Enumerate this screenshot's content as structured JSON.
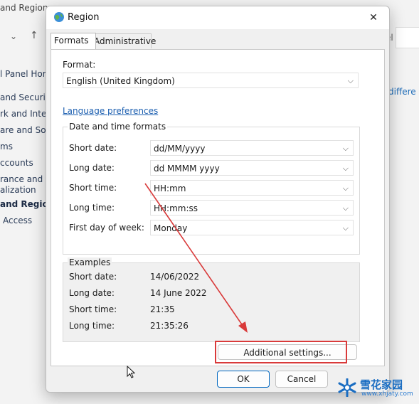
{
  "background": {
    "title": "and Region",
    "nav_chevron": "⌄",
    "nav_up": "↑",
    "right_top": "el",
    "right_link": "differe",
    "sidebar_items": [
      {
        "label": "l Panel Hom",
        "bold": false
      },
      {
        "label": "and Security",
        "bold": false
      },
      {
        "label": "rk and Intern",
        "bold": false
      },
      {
        "label": "are and Soun",
        "bold": false
      },
      {
        "label": "ms",
        "bold": false
      },
      {
        "label": "ccounts",
        "bold": false
      },
      {
        "label": "rance and",
        "bold": false
      },
      {
        "label": "alization",
        "bold": false
      },
      {
        "label": "and Region",
        "bold": true
      },
      {
        "label": "Access",
        "bold": false
      }
    ]
  },
  "dialog": {
    "title": "Region",
    "close_label": "✕",
    "tabs": [
      {
        "label": "Formats",
        "active": true
      },
      {
        "label": "Administrative",
        "active": false
      }
    ],
    "format_label": "Format:",
    "format_value": "English (United Kingdom)",
    "language_link": "Language preferences",
    "date_time_group": {
      "title": "Date and time formats",
      "rows": [
        {
          "label": "Short date:",
          "value": "dd/MM/yyyy"
        },
        {
          "label": "Long date:",
          "value": "dd MMMM yyyy"
        },
        {
          "label": "Short time:",
          "value": "HH:mm"
        },
        {
          "label": "Long time:",
          "value": "HH:mm:ss"
        },
        {
          "label": "First day of week:",
          "value": "Monday"
        }
      ]
    },
    "examples_group": {
      "title": "Examples",
      "rows": [
        {
          "label": "Short date:",
          "value": "14/06/2022"
        },
        {
          "label": "Long date:",
          "value": "14 June 2022"
        },
        {
          "label": "Short time:",
          "value": "21:35"
        },
        {
          "label": "Long time:",
          "value": "21:35:26"
        }
      ]
    },
    "additional_settings": "Additional settings...",
    "ok": "OK",
    "cancel": "Cancel"
  },
  "annotation": {
    "color": "#d93a3a"
  },
  "watermark": {
    "text": "雪花家园",
    "url": "www.xhjaty.com"
  },
  "icons": [
    "globe-icon",
    "close-icon",
    "chevron-down-icon",
    "mouse-cursor-icon",
    "arrow-annotation"
  ]
}
